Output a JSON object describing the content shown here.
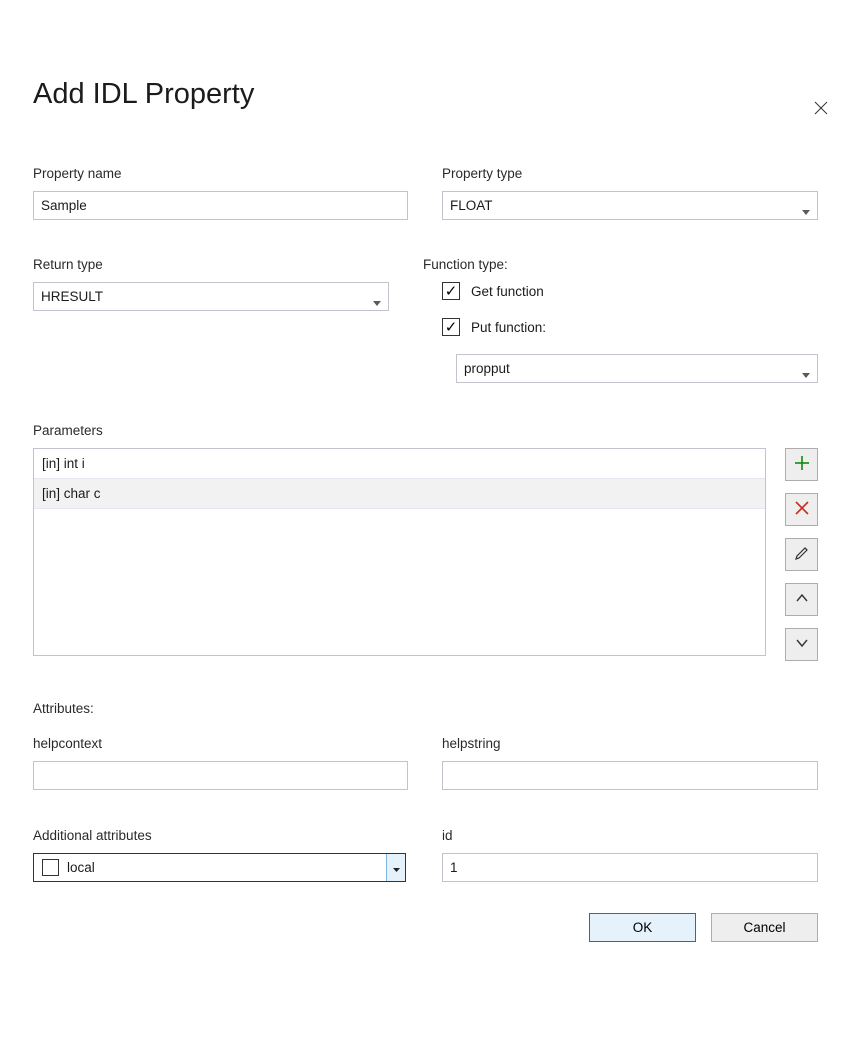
{
  "title": "Add IDL Property",
  "labels": {
    "property_name": "Property name",
    "property_type": "Property type",
    "return_type": "Return type",
    "function_type": "Function type:",
    "get_function": "Get function",
    "put_function": "Put function:",
    "parameters": "Parameters",
    "attributes": "Attributes:",
    "helpcontext": "helpcontext",
    "helpstring": "helpstring",
    "additional_attributes": "Additional attributes",
    "id": "id"
  },
  "values": {
    "property_name": "Sample",
    "property_type": "FLOAT",
    "return_type": "HRESULT",
    "get_function_checked": true,
    "put_function_checked": true,
    "put_type": "propput",
    "helpcontext": "",
    "helpstring": "",
    "additional_attr_option": "local",
    "additional_attr_option_checked": false,
    "id": "1"
  },
  "parameters": [
    {
      "text": "[in] int i",
      "selected": false
    },
    {
      "text": "[in] char c",
      "selected": true
    }
  ],
  "buttons": {
    "ok": "OK",
    "cancel": "Cancel"
  }
}
